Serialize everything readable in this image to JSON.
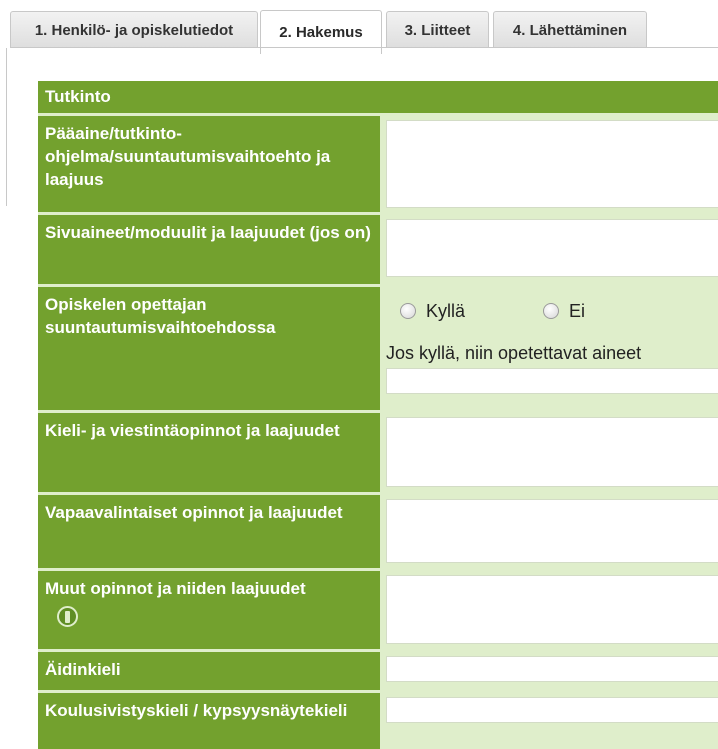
{
  "tabs": [
    {
      "label": "1. Henkilö- ja opiskelutiedot"
    },
    {
      "label": "2. Hakemus"
    },
    {
      "label": "3. Liitteet"
    },
    {
      "label": "4. Lähettäminen"
    }
  ],
  "section": {
    "title": "Tutkinto",
    "rows": {
      "major": "Pääaine/tutkinto-ohjelma/suuntautumisvaihtoehto ja laajuus",
      "minors": "Sivuaineet/moduulit ja laajuudet (jos on)",
      "teacher": "Opiskelen opettajan suuntautumisvaihtoehdossa",
      "languages": "Kieli- ja viestintäopinnot ja laajuudet",
      "elective": "Vapaavalintaiset opinnot ja laajuudet",
      "other": "Muut opinnot ja niiden laajuudet",
      "mother_tongue": "Äidinkieli",
      "school_language": "Koulusivistyskieli / kypsyysnäytekieli"
    },
    "teacher_options": {
      "yes": "Kyllä",
      "no": "Ei",
      "note": "Jos kyllä, niin opetettavat aineet"
    }
  },
  "icons": {
    "info": "info-icon"
  },
  "colors": {
    "label_bg": "#73a12e",
    "value_bg": "#dfeecb"
  }
}
